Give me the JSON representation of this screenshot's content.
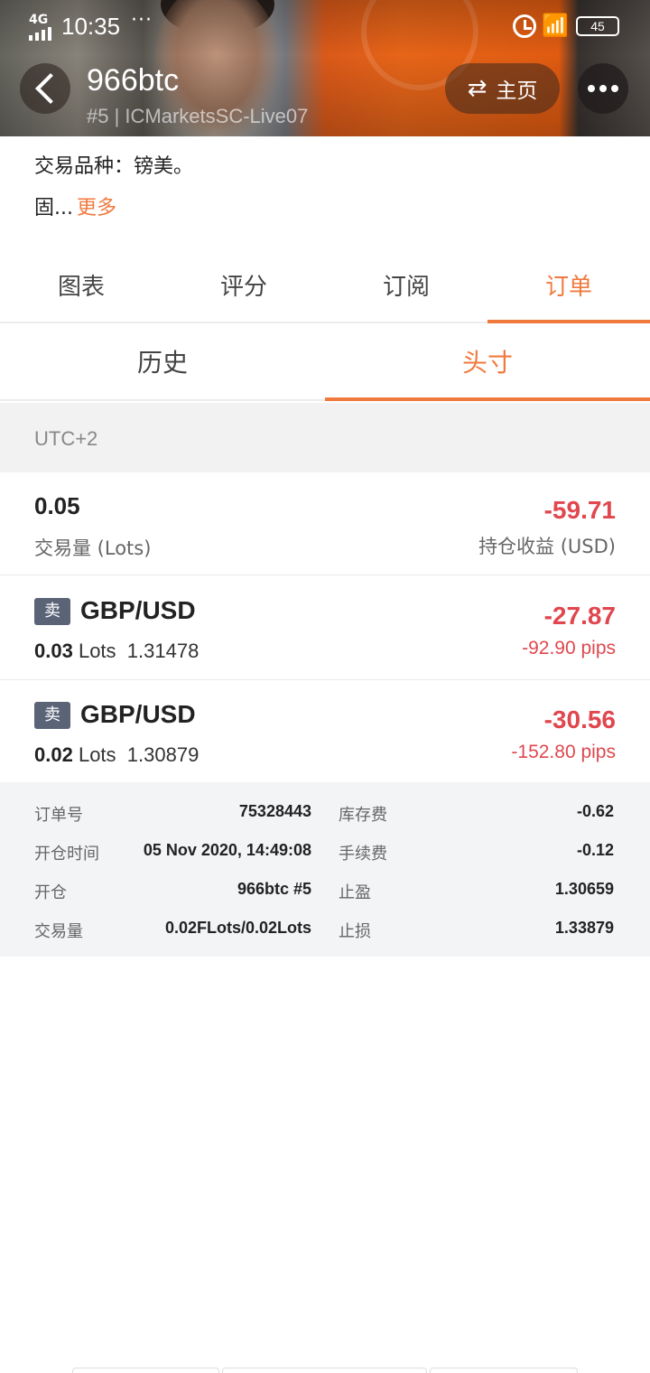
{
  "status_bar": {
    "network": "4G",
    "time": "10:35",
    "dots": "···",
    "battery": "45"
  },
  "header": {
    "title": "966btc",
    "subtitle": "#5 | ICMarketsSC-Live07",
    "home_label": "主页"
  },
  "description": {
    "line1": "交易品种：镑美。",
    "line2": "固...",
    "more": "更多"
  },
  "tabs": [
    {
      "label": "图表"
    },
    {
      "label": "评分"
    },
    {
      "label": "订阅"
    },
    {
      "label": "订单"
    }
  ],
  "active_tab": "订单",
  "subtabs": [
    {
      "label": "历史"
    },
    {
      "label": "头寸"
    }
  ],
  "active_subtab": "头寸",
  "timezone": "UTC+2",
  "summary": {
    "lots": "0.05",
    "lots_label": "交易量 (Lots)",
    "pnl": "-59.71",
    "pnl_label": "持仓收益 (USD)"
  },
  "positions": [
    {
      "side": "卖",
      "symbol": "GBP/USD",
      "lots": "0.03",
      "lots_unit": "Lots",
      "price": "1.31478",
      "pnl": "-27.87",
      "pips": "-92.90 pips"
    },
    {
      "side": "卖",
      "symbol": "GBP/USD",
      "lots": "0.02",
      "lots_unit": "Lots",
      "price": "1.30879",
      "pnl": "-30.56",
      "pips": "-152.80 pips"
    }
  ],
  "order_details": [
    {
      "k1": "订单号",
      "v1": "75328443",
      "k2": "库存费",
      "v2": "-0.62"
    },
    {
      "k1": "开仓时间",
      "v1": "05 Nov 2020, 14:49:08",
      "k2": "手续费",
      "v2": "-0.12"
    },
    {
      "k1": "开仓",
      "v1": "966btc  #5",
      "k2": "止盈",
      "v2": "1.30659"
    },
    {
      "k1": "交易量",
      "v1": "0.02FLots/0.02Lots",
      "k2": "止损",
      "v2": "1.33879"
    }
  ],
  "colors": {
    "accent": "#f07a3e",
    "loss": "#e0474f",
    "sell_badge": "#5b6377"
  }
}
